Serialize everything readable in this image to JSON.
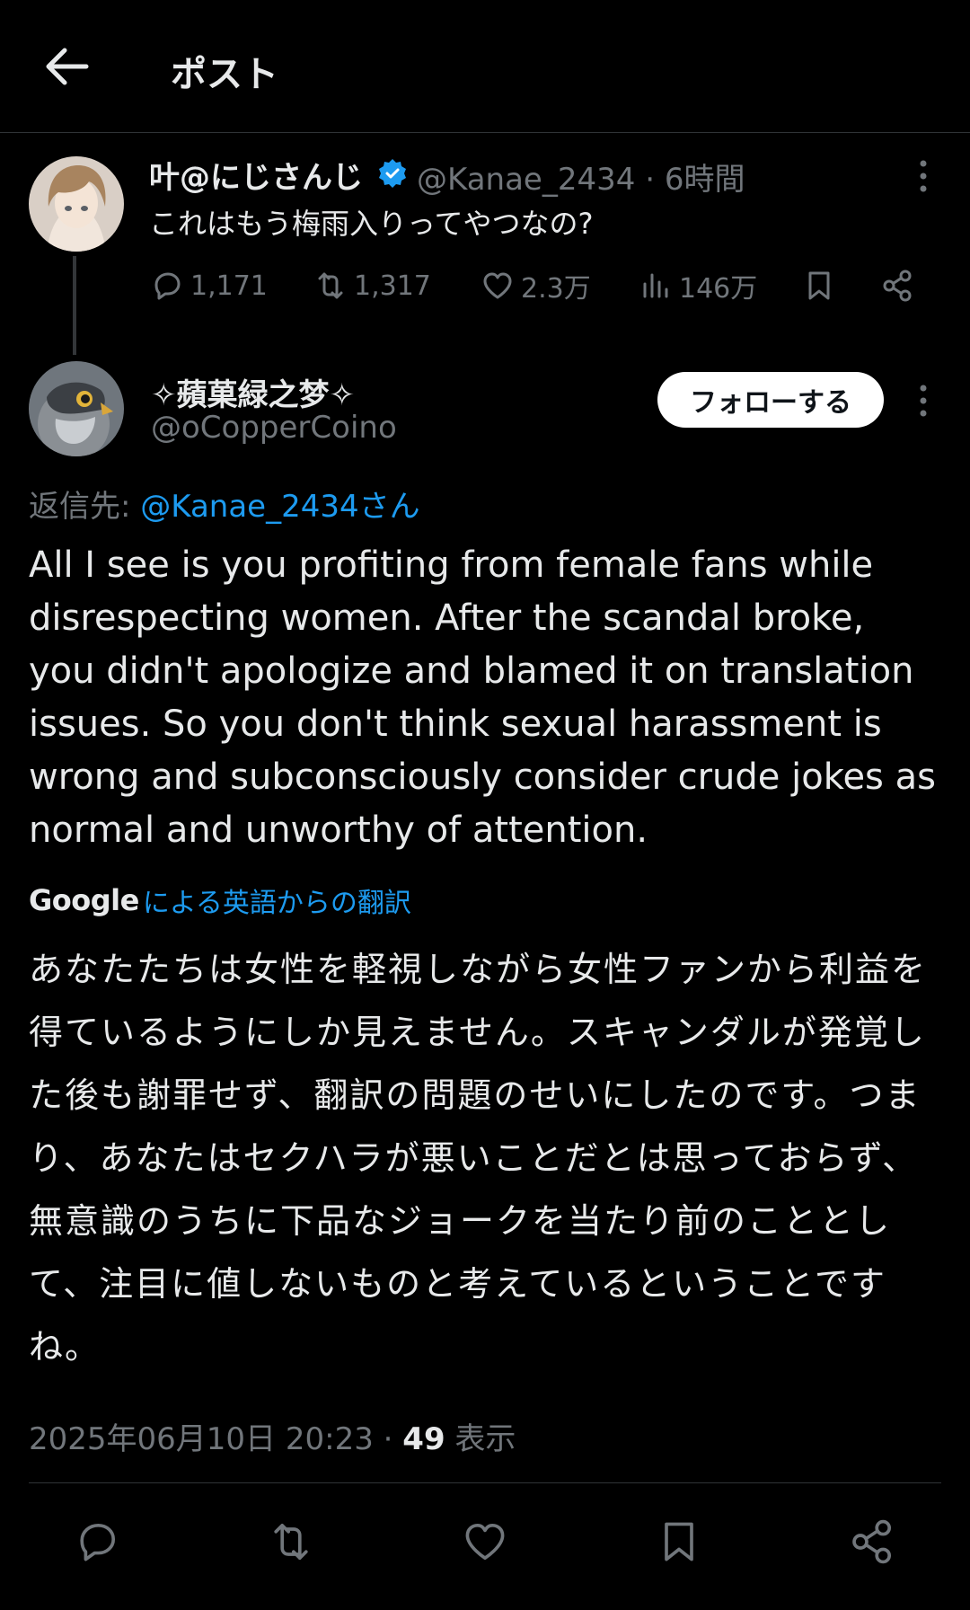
{
  "header": {
    "title": "ポスト"
  },
  "parent_post": {
    "display_name": "叶@にじさんじ",
    "handle": "@Kanae_2434",
    "separator": "·",
    "time_ago": "6時間",
    "text": "これはもう梅雨入りってやつなの?",
    "stats": {
      "replies": "1,171",
      "reposts": "1,317",
      "likes": "2.3万",
      "views": "146万"
    }
  },
  "reply_post": {
    "display_name": "✧蘋菓緑之梦✧",
    "handle": "@oCopperCoino",
    "follow_label": "フォローする",
    "replying_prefix": "返信先: ",
    "replying_to": "@Kanae_2434さん",
    "text": "All I see is you profiting from female fans while disrespecting women. After the scandal broke, you didn't apologize and blamed it on translation issues. So you don't think sexual harassment is wrong and subconsciously consider crude jokes as normal and unworthy of attention.",
    "translation_brand": "Google",
    "translation_label": "による英語からの翻訳",
    "translated_text": "あなたたちは女性を軽視しながら女性ファンから利益を得ているようにしか見えません。スキャンダルが発覚した後も謝罪せず、翻訳の問題のせいにしたのです。つまり、あなたはセクハラが悪いことだとは思っておらず、無意識のうちに下品なジョークを当たり前のこととして、注目に値しないものと考えているということですね。",
    "timestamp": "2025年06月10日 20:23",
    "separator": " · ",
    "view_count": "49",
    "view_label": " 表示"
  },
  "colors": {
    "background": "#000000",
    "text": "#e7e9ea",
    "muted": "#71767b",
    "link": "#1d9bf0",
    "verified": "#1d9bf0"
  }
}
